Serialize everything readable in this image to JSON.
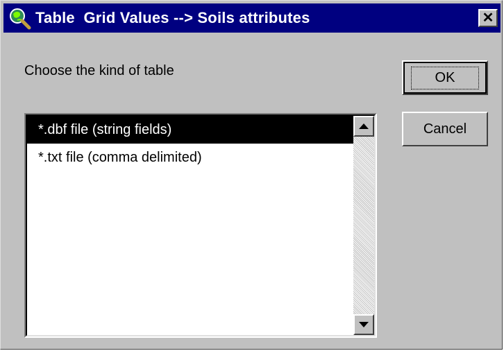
{
  "window": {
    "title": "Table  Grid Values --> Soils attributes",
    "icon": "globe-magnifier-icon",
    "close_glyph": "✕"
  },
  "prompt": "Choose the kind of table",
  "buttons": {
    "ok_label": "OK",
    "cancel_label": "Cancel"
  },
  "list": {
    "items": [
      {
        "label": "*.dbf file (string fields)",
        "selected": true
      },
      {
        "label": "*.txt file (comma delimited)",
        "selected": false
      }
    ]
  },
  "colors": {
    "titlebar": "#000080",
    "face": "#c0c0c0",
    "selection": "#000000"
  }
}
